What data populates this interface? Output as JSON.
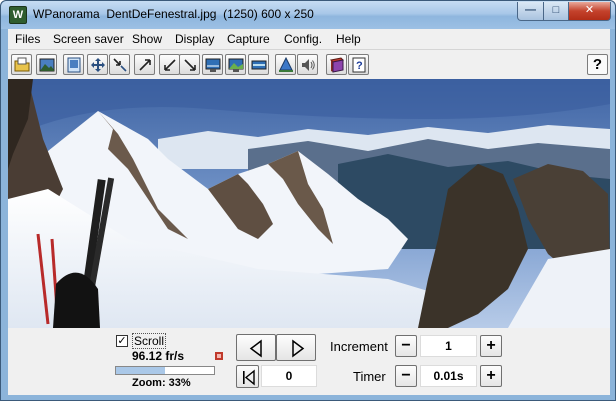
{
  "window": {
    "title": "WPanorama  DentDeFenestral.jpg  (1250) 600 x 250",
    "app_icon_letter": "W",
    "min_glyph": "—",
    "max_glyph": "□",
    "close_glyph": "✕"
  },
  "menu": {
    "items": [
      "Files",
      "Screen saver",
      "Show",
      "Display",
      "Capture",
      "Config.",
      "Help"
    ]
  },
  "toolbar": {
    "icons": [
      "open-folder-icon",
      "landscape-image-icon",
      "page-icon",
      "move-arrows-icon",
      "shrink-arrows-icon",
      "expand-up-right-icon",
      "shrink-down-left-icon",
      "expand-down-right-icon",
      "monitor-icon",
      "monitor-image-icon",
      "monitor-wide-icon",
      "pyramid-icon",
      "speaker-icon",
      "book-icon",
      "help-page-icon"
    ],
    "help_label": "?"
  },
  "controls": {
    "scroll_checked": "✓",
    "scroll_label": "Scroll",
    "fps": "96.12 fr/s",
    "zoom_label": "Zoom: 33%",
    "zoom_fraction": 0.5,
    "position_value": "0",
    "increment_label": "Increment",
    "increment_value": "1",
    "timer_label": "Timer",
    "timer_value": "0.01s",
    "minus": "−",
    "plus": "+"
  }
}
